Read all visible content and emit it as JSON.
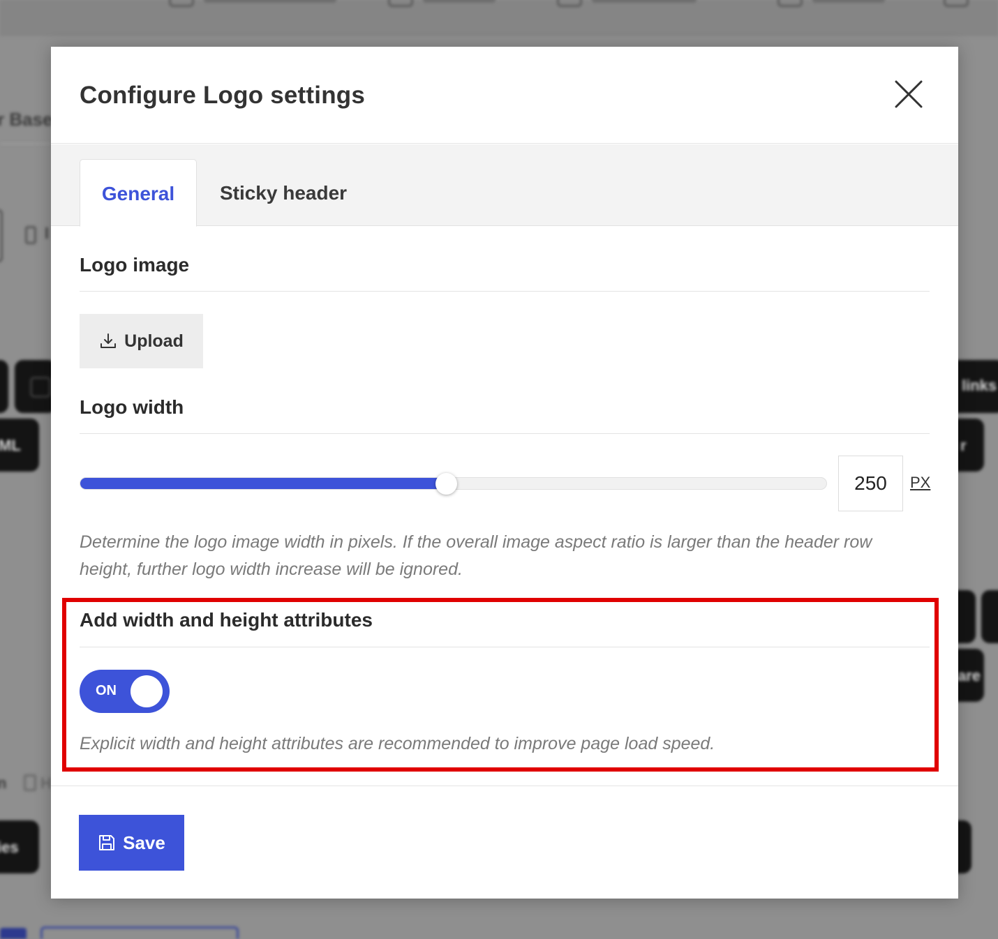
{
  "modal": {
    "title": "Configure Logo settings",
    "tabs": [
      {
        "label": "General",
        "active": true
      },
      {
        "label": "Sticky header",
        "active": false
      }
    ],
    "logo_image": {
      "label": "Logo image",
      "upload_label": "Upload",
      "upload_icon": "download-icon"
    },
    "logo_width": {
      "label": "Logo width",
      "value": "250",
      "unit": "PX",
      "slider_fraction": 0.49,
      "help": "Determine the logo image width in pixels. If the overall image aspect ratio is larger than the header row height, further logo width increase will be ignored."
    },
    "attributes": {
      "label": "Add width and height attributes",
      "toggle_label": "ON",
      "toggle_on": true,
      "help": "Explicit width and height attributes are recommended to improve page load speed."
    },
    "save_label": "Save",
    "save_icon": "floppy-disk-icon",
    "close_icon": "close-icon"
  },
  "colors": {
    "accent": "#3d53d9",
    "highlight": "#e00000",
    "backdrop": "#8f8f8f"
  },
  "background_app": {
    "fragments": [
      "r Base",
      "links",
      "ML",
      "r",
      "are",
      "n",
      "H",
      "ies"
    ]
  }
}
